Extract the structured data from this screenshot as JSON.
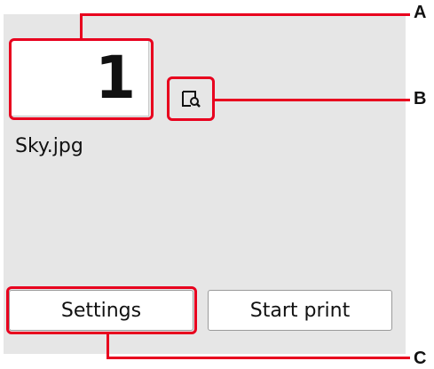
{
  "copies": {
    "value": "1"
  },
  "file": {
    "name": "Sky.jpg"
  },
  "buttons": {
    "settings": "Settings",
    "start_print": "Start print"
  },
  "callouts": {
    "a": "A",
    "b": "B",
    "c": "C"
  },
  "colors": {
    "highlight": "#e8001e",
    "screen_bg": "#e6e6e6"
  },
  "icons": {
    "preview": "preview-magnifier-icon"
  }
}
